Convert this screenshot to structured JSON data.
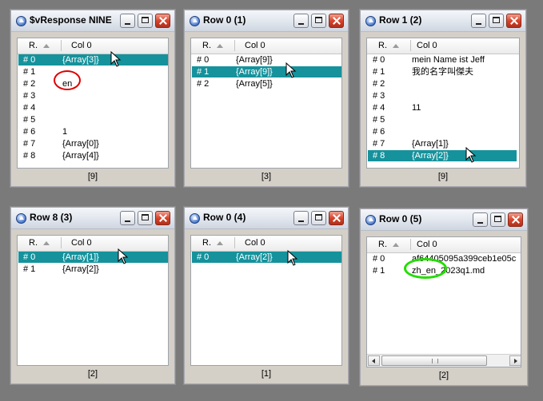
{
  "header": {
    "index_col": "R.",
    "col0": "Col 0"
  },
  "windows": [
    {
      "title": "$vResponse NINE",
      "footer": "[9]",
      "rows": [
        {
          "idx": "# 0",
          "val": "{Array[3]}",
          "selected": true
        },
        {
          "idx": "# 1",
          "val": ""
        },
        {
          "idx": "# 2",
          "val": "en"
        },
        {
          "idx": "# 3",
          "val": ""
        },
        {
          "idx": "# 4",
          "val": ""
        },
        {
          "idx": "# 5",
          "val": ""
        },
        {
          "idx": "# 6",
          "val": "1"
        },
        {
          "idx": "# 7",
          "val": "{Array[0]}"
        },
        {
          "idx": "# 8",
          "val": "{Array[4]}"
        }
      ]
    },
    {
      "title": "Row 0 (1)",
      "footer": "[3]",
      "rows": [
        {
          "idx": "# 0",
          "val": "{Array[9]}"
        },
        {
          "idx": "# 1",
          "val": "{Array[9]}",
          "selected": true
        },
        {
          "idx": "# 2",
          "val": "{Array[5]}"
        }
      ]
    },
    {
      "title": "Row 1 (2)",
      "footer": "[9]",
      "rows": [
        {
          "idx": "# 0",
          "val": "mein Name ist Jeff"
        },
        {
          "idx": "# 1",
          "val": "我的名字叫傑夫"
        },
        {
          "idx": "# 2",
          "val": ""
        },
        {
          "idx": "# 3",
          "val": ""
        },
        {
          "idx": "# 4",
          "val": "11"
        },
        {
          "idx": "# 5",
          "val": ""
        },
        {
          "idx": "# 6",
          "val": ""
        },
        {
          "idx": "# 7",
          "val": "{Array[1]}"
        },
        {
          "idx": "# 8",
          "val": "{Array[2]}",
          "selected": true
        }
      ]
    },
    {
      "title": "Row 8 (3)",
      "footer": "[2]",
      "rows": [
        {
          "idx": "# 0",
          "val": "{Array[1]}",
          "selected": true
        },
        {
          "idx": "# 1",
          "val": "{Array[2]}"
        }
      ]
    },
    {
      "title": "Row 0 (4)",
      "footer": "[1]",
      "rows": [
        {
          "idx": "# 0",
          "val": "{Array[2]}",
          "selected": true
        }
      ]
    },
    {
      "title": "Row 0 (5)",
      "footer": "[2]",
      "rows": [
        {
          "idx": "# 0",
          "val": "af64405095a399ceb1e05c"
        },
        {
          "idx": "# 1",
          "val": "zh_en_2023q1.md"
        }
      ]
    }
  ],
  "colors": {
    "selection": "#15929c",
    "highlight_red": "#e00000",
    "highlight_green": "#22dd00"
  }
}
